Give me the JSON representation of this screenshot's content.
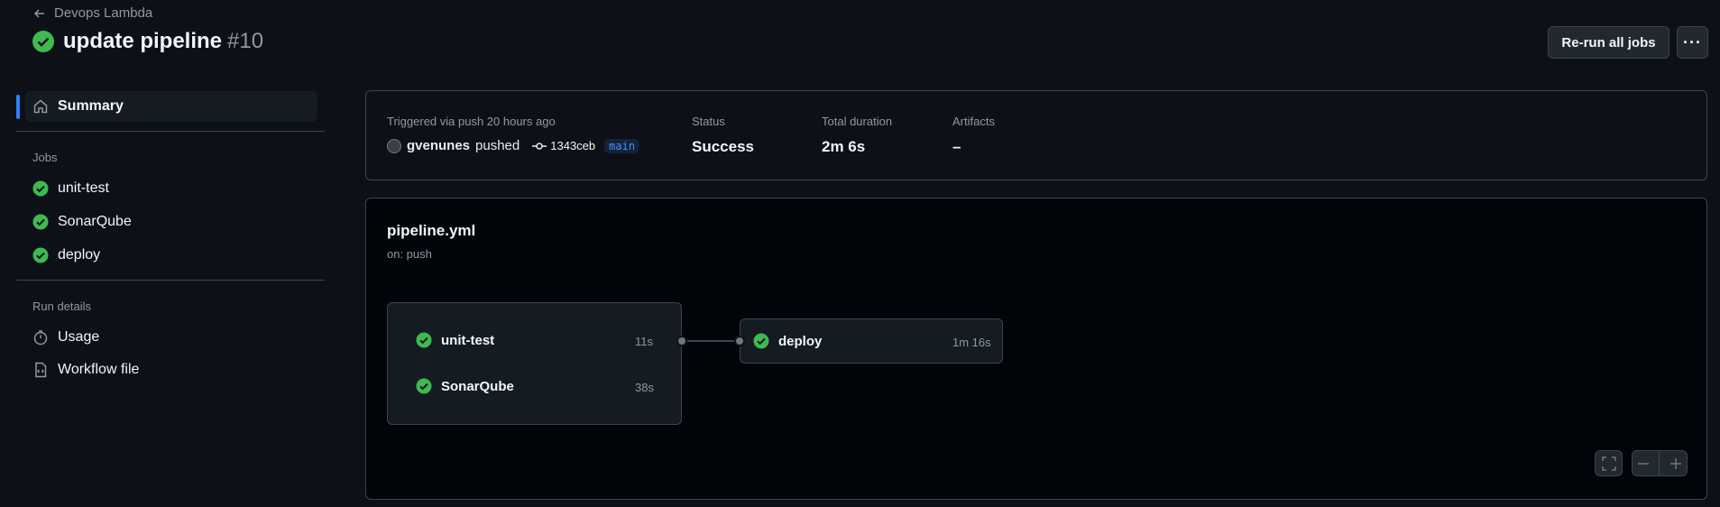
{
  "header": {
    "back_label": "Devops Lambda",
    "title": "update pipeline",
    "run_number": "#10",
    "rerun_label": "Re-run all jobs",
    "more_label": "···"
  },
  "sidebar": {
    "summary_label": "Summary",
    "jobs_heading": "Jobs",
    "jobs": [
      {
        "label": "unit-test",
        "status": "success"
      },
      {
        "label": "SonarQube",
        "status": "success"
      },
      {
        "label": "deploy",
        "status": "success"
      }
    ],
    "run_details_heading": "Run details",
    "usage_label": "Usage",
    "workflow_file_label": "Workflow file"
  },
  "summary": {
    "trigger_text": "Triggered via push 20 hours ago",
    "actor": "gvenunes",
    "action": "pushed",
    "commit_sha": "1343ceb",
    "branch": "main",
    "status_label": "Status",
    "status_value": "Success",
    "duration_label": "Total duration",
    "duration_value": "2m 6s",
    "artifacts_label": "Artifacts",
    "artifacts_value": "–"
  },
  "workflow": {
    "filename": "pipeline.yml",
    "trigger": "on: push",
    "jobs": [
      {
        "name": "unit-test",
        "duration": "11s"
      },
      {
        "name": "SonarQube",
        "duration": "38s"
      },
      {
        "name": "deploy",
        "duration": "1m 16s"
      }
    ]
  },
  "colors": {
    "success": "#3fb950",
    "accent": "#2f81f7",
    "background": "#0d1117"
  },
  "icons": [
    "arrow-left-icon",
    "check-circle-icon",
    "home-icon",
    "stopwatch-icon",
    "file-code-icon",
    "commit-icon",
    "fullscreen-icon",
    "zoom-out-icon",
    "zoom-in-icon"
  ]
}
